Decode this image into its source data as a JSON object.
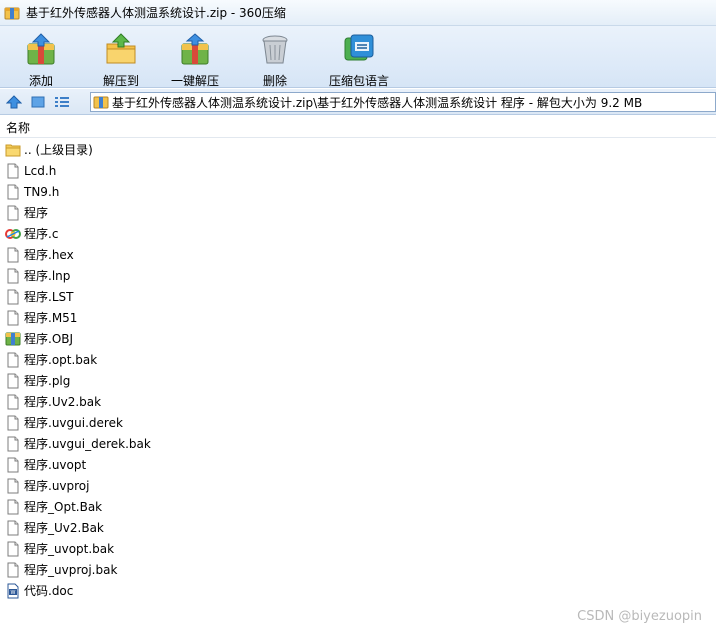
{
  "window": {
    "title": "基于红外传感器人体测温系统设计.zip - 360压缩"
  },
  "toolbar": {
    "add_label": "添加",
    "extract_label": "解压到",
    "onekey_label": "一键解压",
    "delete_label": "删除",
    "lang_label": "压缩包语言"
  },
  "address": {
    "path": "基于红外传感器人体测温系统设计.zip\\基于红外传感器人体测温系统设计 程序 - 解包大小为 9.2 MB"
  },
  "list": {
    "header_name": "名称",
    "files": [
      {
        "name": ".. (上级目录)",
        "icon": "folder-icon"
      },
      {
        "name": "Lcd.h",
        "icon": "file-icon"
      },
      {
        "name": "TN9.h",
        "icon": "file-icon"
      },
      {
        "name": "程序",
        "icon": "file-icon"
      },
      {
        "name": "程序.c",
        "icon": "c-source-icon"
      },
      {
        "name": "程序.hex",
        "icon": "file-icon"
      },
      {
        "name": "程序.lnp",
        "icon": "file-icon"
      },
      {
        "name": "程序.LST",
        "icon": "file-icon"
      },
      {
        "name": "程序.M51",
        "icon": "file-icon"
      },
      {
        "name": "程序.OBJ",
        "icon": "archive-icon"
      },
      {
        "name": "程序.opt.bak",
        "icon": "file-icon"
      },
      {
        "name": "程序.plg",
        "icon": "file-icon"
      },
      {
        "name": "程序.Uv2.bak",
        "icon": "file-icon"
      },
      {
        "name": "程序.uvgui.derek",
        "icon": "file-icon"
      },
      {
        "name": "程序.uvgui_derek.bak",
        "icon": "file-icon"
      },
      {
        "name": "程序.uvopt",
        "icon": "file-icon"
      },
      {
        "name": "程序.uvproj",
        "icon": "file-icon"
      },
      {
        "name": "程序_Opt.Bak",
        "icon": "file-icon"
      },
      {
        "name": "程序_Uv2.Bak",
        "icon": "file-icon"
      },
      {
        "name": "程序_uvopt.bak",
        "icon": "file-icon"
      },
      {
        "name": "程序_uvproj.bak",
        "icon": "file-icon"
      },
      {
        "name": "代码.doc",
        "icon": "word-doc-icon"
      }
    ]
  },
  "watermark": "CSDN @biyezuopin"
}
